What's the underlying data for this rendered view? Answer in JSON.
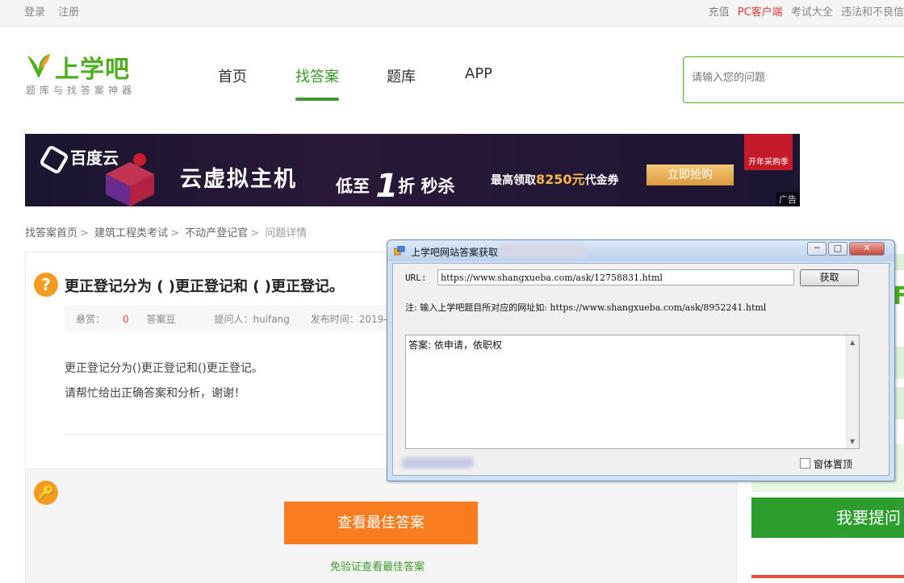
{
  "topbar": {
    "login": "登录",
    "register": "注册",
    "links": [
      "充值",
      "PC客户端",
      "考试大全",
      "违法和不良信"
    ]
  },
  "logo": {
    "brand": "上学吧",
    "slogan": "题库与找答案神器"
  },
  "nav": {
    "items": [
      "首页",
      "找答案",
      "题库",
      "APP"
    ],
    "active": "找答案"
  },
  "search": {
    "placeholder": "请输入您的问题"
  },
  "banner": {
    "brand": "百度云",
    "title": "云虚拟主机",
    "low": "低至",
    "discount": "1",
    "discount_unit": "折",
    "flash": "秒杀",
    "coupon_prefix": "最高领取",
    "coupon_amount": "8250元",
    "coupon_suffix": "代金券",
    "cta": "立即抢购",
    "tag": "开年采购季",
    "ad": "广告"
  },
  "breadcrumb": [
    "找答案首页",
    "建筑工程类考试",
    "不动产登记官",
    "问题详情"
  ],
  "question": {
    "title": "更正登记分为 ( )更正登记和 ( )更正登记。",
    "reward_label": "悬赏：",
    "reward_value": "0",
    "reward_unit": "答案豆",
    "asker": "提问人：huifang",
    "date": "发布时间：2019-01-10",
    "body1": "更正登记分为()更正登记和()更正登记。",
    "body2": "请帮忙给出正确答案和分析，谢谢！"
  },
  "answer_section": {
    "button": "查看最佳答案",
    "link": "免验证查看最佳答案"
  },
  "side": {
    "ask_button": "我要提问",
    "partial_char": "F"
  },
  "dialog": {
    "title": "上学吧网站答案获取",
    "minimize": "─",
    "maximize": "□",
    "close": "✕",
    "url_label": "URL:",
    "url_value": "https://www.shangxueba.com/ask/12758831.html",
    "fetch_button": "获取",
    "note": "注:   输入上学吧题目所对应的网址如: https://www.shangxueba.com/ask/8952241.html",
    "answer": "答案: 依申请，依职权",
    "pin_label": "窗体置顶"
  },
  "colors": {
    "green": "#3a9a2a",
    "orange": "#f97d1e",
    "red": "#e4393c"
  }
}
